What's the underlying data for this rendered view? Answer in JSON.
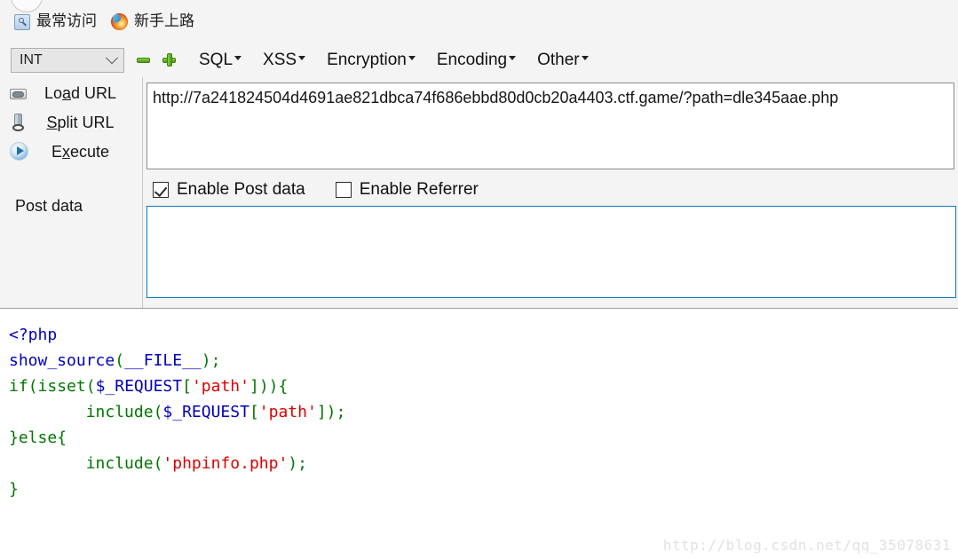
{
  "browser": {
    "bookmarks": [
      {
        "label": "最常访问",
        "icon": "most-visited-icon"
      },
      {
        "label": "新手上路",
        "icon": "firefox-icon"
      }
    ]
  },
  "toolbar": {
    "type_select": {
      "value": "INT",
      "icon": "chevron-down-icon"
    },
    "remove_button": {
      "icon": "minus-icon",
      "label": ""
    },
    "add_button": {
      "icon": "plus-icon",
      "label": ""
    },
    "menus": [
      {
        "label": "SQL"
      },
      {
        "label": "XSS"
      },
      {
        "label": "Encryption"
      },
      {
        "label": "Encoding"
      },
      {
        "label": "Other"
      }
    ]
  },
  "sidebar": {
    "buttons": [
      {
        "label_pre": "Lo",
        "label_accel": "a",
        "label_post": "d URL",
        "icon": "disk-load-icon"
      },
      {
        "label_pre": "",
        "label_accel": "S",
        "label_post": "plit URL",
        "icon": "scissors-icon"
      },
      {
        "label_pre": "E",
        "label_accel": "x",
        "label_post": "ecute",
        "icon": "play-execute-icon"
      }
    ],
    "post_data_label": "Post data"
  },
  "fields": {
    "url_value": "http://7a241824504d4691ae821dbca74f686ebbd80d0cb20a4403.ctf.game/?path=dle345aae.php",
    "url_placeholder": "",
    "post_data_value": "",
    "post_data_placeholder": ""
  },
  "checkboxes": [
    {
      "label": "Enable Post data",
      "checked": true
    },
    {
      "label": "Enable Referrer",
      "checked": false
    }
  ],
  "code": {
    "lines": [
      [
        {
          "t": "<?php",
          "c": "tk-open"
        }
      ],
      [
        {
          "t": "show_source",
          "c": "tk-fn"
        },
        {
          "t": "(",
          "c": "tk-punct"
        },
        {
          "t": "__FILE__",
          "c": "tk-var"
        },
        {
          "t": ")",
          "c": "tk-punct"
        },
        {
          "t": ";",
          "c": "tk-punct"
        }
      ],
      [
        {
          "t": "if",
          "c": "tk-kw"
        },
        {
          "t": "(",
          "c": "tk-punct"
        },
        {
          "t": "isset",
          "c": "tk-kw"
        },
        {
          "t": "(",
          "c": "tk-punct"
        },
        {
          "t": "$_REQUEST",
          "c": "tk-var"
        },
        {
          "t": "[",
          "c": "tk-punct"
        },
        {
          "t": "'path'",
          "c": "tk-str"
        },
        {
          "t": "]))",
          "c": "tk-punct"
        },
        {
          "t": "{",
          "c": "tk-punct"
        }
      ],
      [
        {
          "t": "        ",
          "c": ""
        },
        {
          "t": "include",
          "c": "tk-kw"
        },
        {
          "t": "(",
          "c": "tk-punct"
        },
        {
          "t": "$_REQUEST",
          "c": "tk-var"
        },
        {
          "t": "[",
          "c": "tk-punct"
        },
        {
          "t": "'path'",
          "c": "tk-str"
        },
        {
          "t": "]",
          "c": "tk-punct"
        },
        {
          "t": ")",
          "c": "tk-punct"
        },
        {
          "t": ";",
          "c": "tk-punct"
        }
      ],
      [
        {
          "t": "}",
          "c": "tk-punct"
        },
        {
          "t": "else",
          "c": "tk-kw"
        },
        {
          "t": "{",
          "c": "tk-punct"
        }
      ],
      [
        {
          "t": "        ",
          "c": ""
        },
        {
          "t": "include",
          "c": "tk-kw"
        },
        {
          "t": "(",
          "c": "tk-punct"
        },
        {
          "t": "'phpinfo.php'",
          "c": "tk-str"
        },
        {
          "t": ")",
          "c": "tk-punct"
        },
        {
          "t": ";",
          "c": "tk-punct"
        }
      ],
      [
        {
          "t": "}",
          "c": "tk-punct"
        }
      ]
    ]
  },
  "watermark": "http://blog.csdn.net/qq_35078631",
  "colors": {
    "panel_bg": "#f4f4f4",
    "focus_border": "#0b76c4",
    "accent_green": "#4e9a18",
    "code_keyword": "#007700",
    "code_variable": "#0000BB",
    "code_string": "#DD0000"
  }
}
